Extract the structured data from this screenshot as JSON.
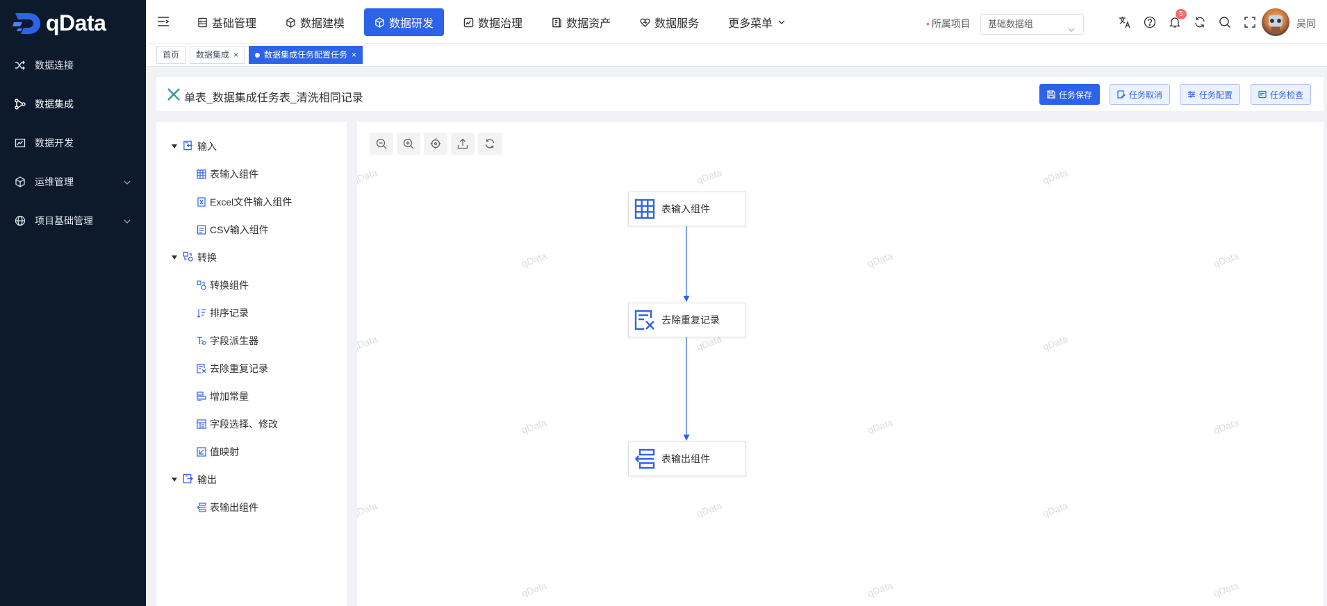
{
  "app": {
    "logo_text": "qData",
    "user_name": "吴同"
  },
  "sidebar": {
    "items": [
      {
        "label": "数据连接",
        "icon": "shuffle-icon"
      },
      {
        "label": "数据集成",
        "icon": "integration-icon",
        "active": true
      },
      {
        "label": "数据开发",
        "icon": "chart-icon"
      },
      {
        "label": "运维管理",
        "icon": "cube-icon",
        "expandable": true
      },
      {
        "label": "项目基础管理",
        "icon": "globe-icon",
        "expandable": true
      }
    ]
  },
  "topnav": {
    "items": [
      {
        "label": "基础管理",
        "icon": "database-icon"
      },
      {
        "label": "数据建模",
        "icon": "cube-icon"
      },
      {
        "label": "数据研发",
        "icon": "code-cube-icon",
        "active": true
      },
      {
        "label": "数据治理",
        "icon": "shield-icon"
      },
      {
        "label": "数据资产",
        "icon": "asset-icon"
      },
      {
        "label": "数据服务",
        "icon": "heart-icon"
      },
      {
        "label": "更多菜单",
        "icon": "chevron-down-icon"
      }
    ],
    "project_label": "所属项目",
    "project_value": "基础数据组",
    "notification_count": "5"
  },
  "tabs": [
    {
      "label": "首页",
      "closable": false
    },
    {
      "label": "数据集成",
      "closable": true
    },
    {
      "label": "数据集成任务配置任务",
      "closable": true,
      "active": true
    }
  ],
  "task": {
    "title": "单表_数据集成任务表_清洗相同记录",
    "buttons": {
      "save": "任务保存",
      "cancel": "任务取消",
      "config": "任务配置",
      "check": "任务检查"
    }
  },
  "panel": {
    "groups": [
      {
        "label": "输入",
        "items": [
          "表输入组件",
          "Excel文件输入组件",
          "CSV输入组件"
        ]
      },
      {
        "label": "转换",
        "items": [
          "转换组件",
          "排序记录",
          "字段派生器",
          "去除重复记录",
          "增加常量",
          "字段选择、修改",
          "值映射"
        ]
      },
      {
        "label": "输出",
        "items": [
          "表输出组件"
        ]
      }
    ]
  },
  "canvas": {
    "watermark": "qData",
    "nodes": [
      {
        "label": "表输入组件",
        "icon": "table-grid-icon"
      },
      {
        "label": "去除重复记录",
        "icon": "dedupe-icon"
      },
      {
        "label": "表输出组件",
        "icon": "table-output-icon"
      }
    ],
    "edge_color": "#2d63e8"
  },
  "colors": {
    "primary": "#2d63e8",
    "sidebar_bg": "#0c1a2b",
    "danger": "#f56c6c"
  }
}
